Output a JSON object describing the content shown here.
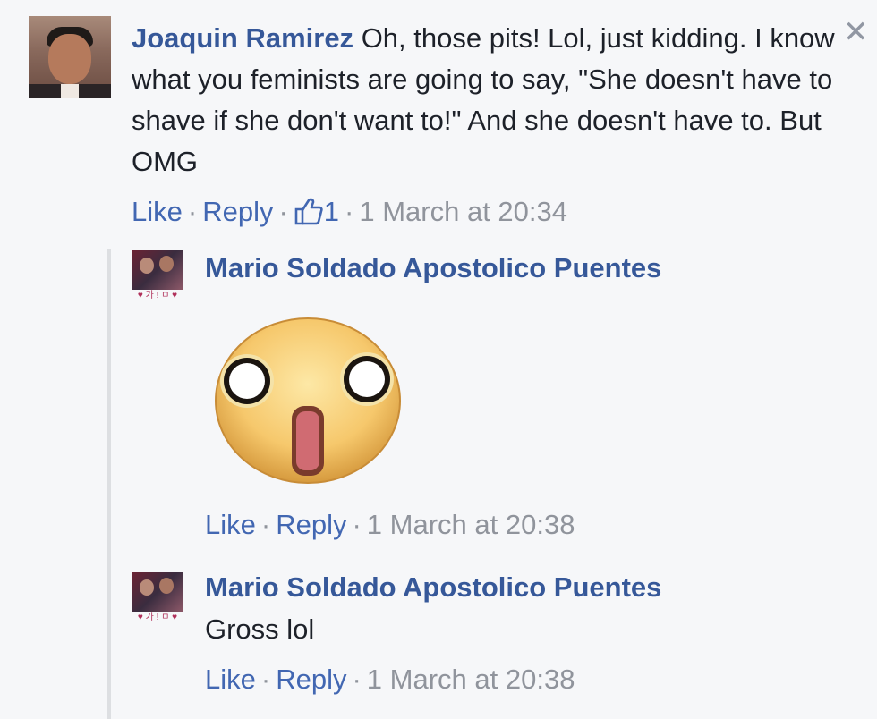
{
  "main_comment": {
    "author": "Joaquin Ramirez",
    "text": "Oh, those pits! Lol, just kidding. I know what you feminists are going to say, \"She doesn't have to shave if she don't want to!\" And she doesn't have to. But OMG",
    "like_label": "Like",
    "reply_label": "Reply",
    "like_count": "1",
    "timestamp": "1 March at 20:34",
    "close_label": "✕",
    "like_icon": "thumbs-up-icon"
  },
  "replies": [
    {
      "author": "Mario Soldado Apostolico Puentes",
      "text": "",
      "sticker": "shocked-face-sticker",
      "avatar_caption": "♥ 가 ! ㅁ ♥",
      "like_label": "Like",
      "reply_label": "Reply",
      "timestamp": "1 March at 20:38"
    },
    {
      "author": "Mario Soldado Apostolico Puentes",
      "text": "Gross lol",
      "avatar_caption": "♥ 가 ! ㅁ ♥",
      "like_label": "Like",
      "reply_label": "Reply",
      "timestamp": "1 March at 20:38"
    }
  ],
  "colors": {
    "background": "#f6f7f9",
    "author": "#365899",
    "link": "#4267b2",
    "meta": "#90949c",
    "text": "#1d2129"
  }
}
